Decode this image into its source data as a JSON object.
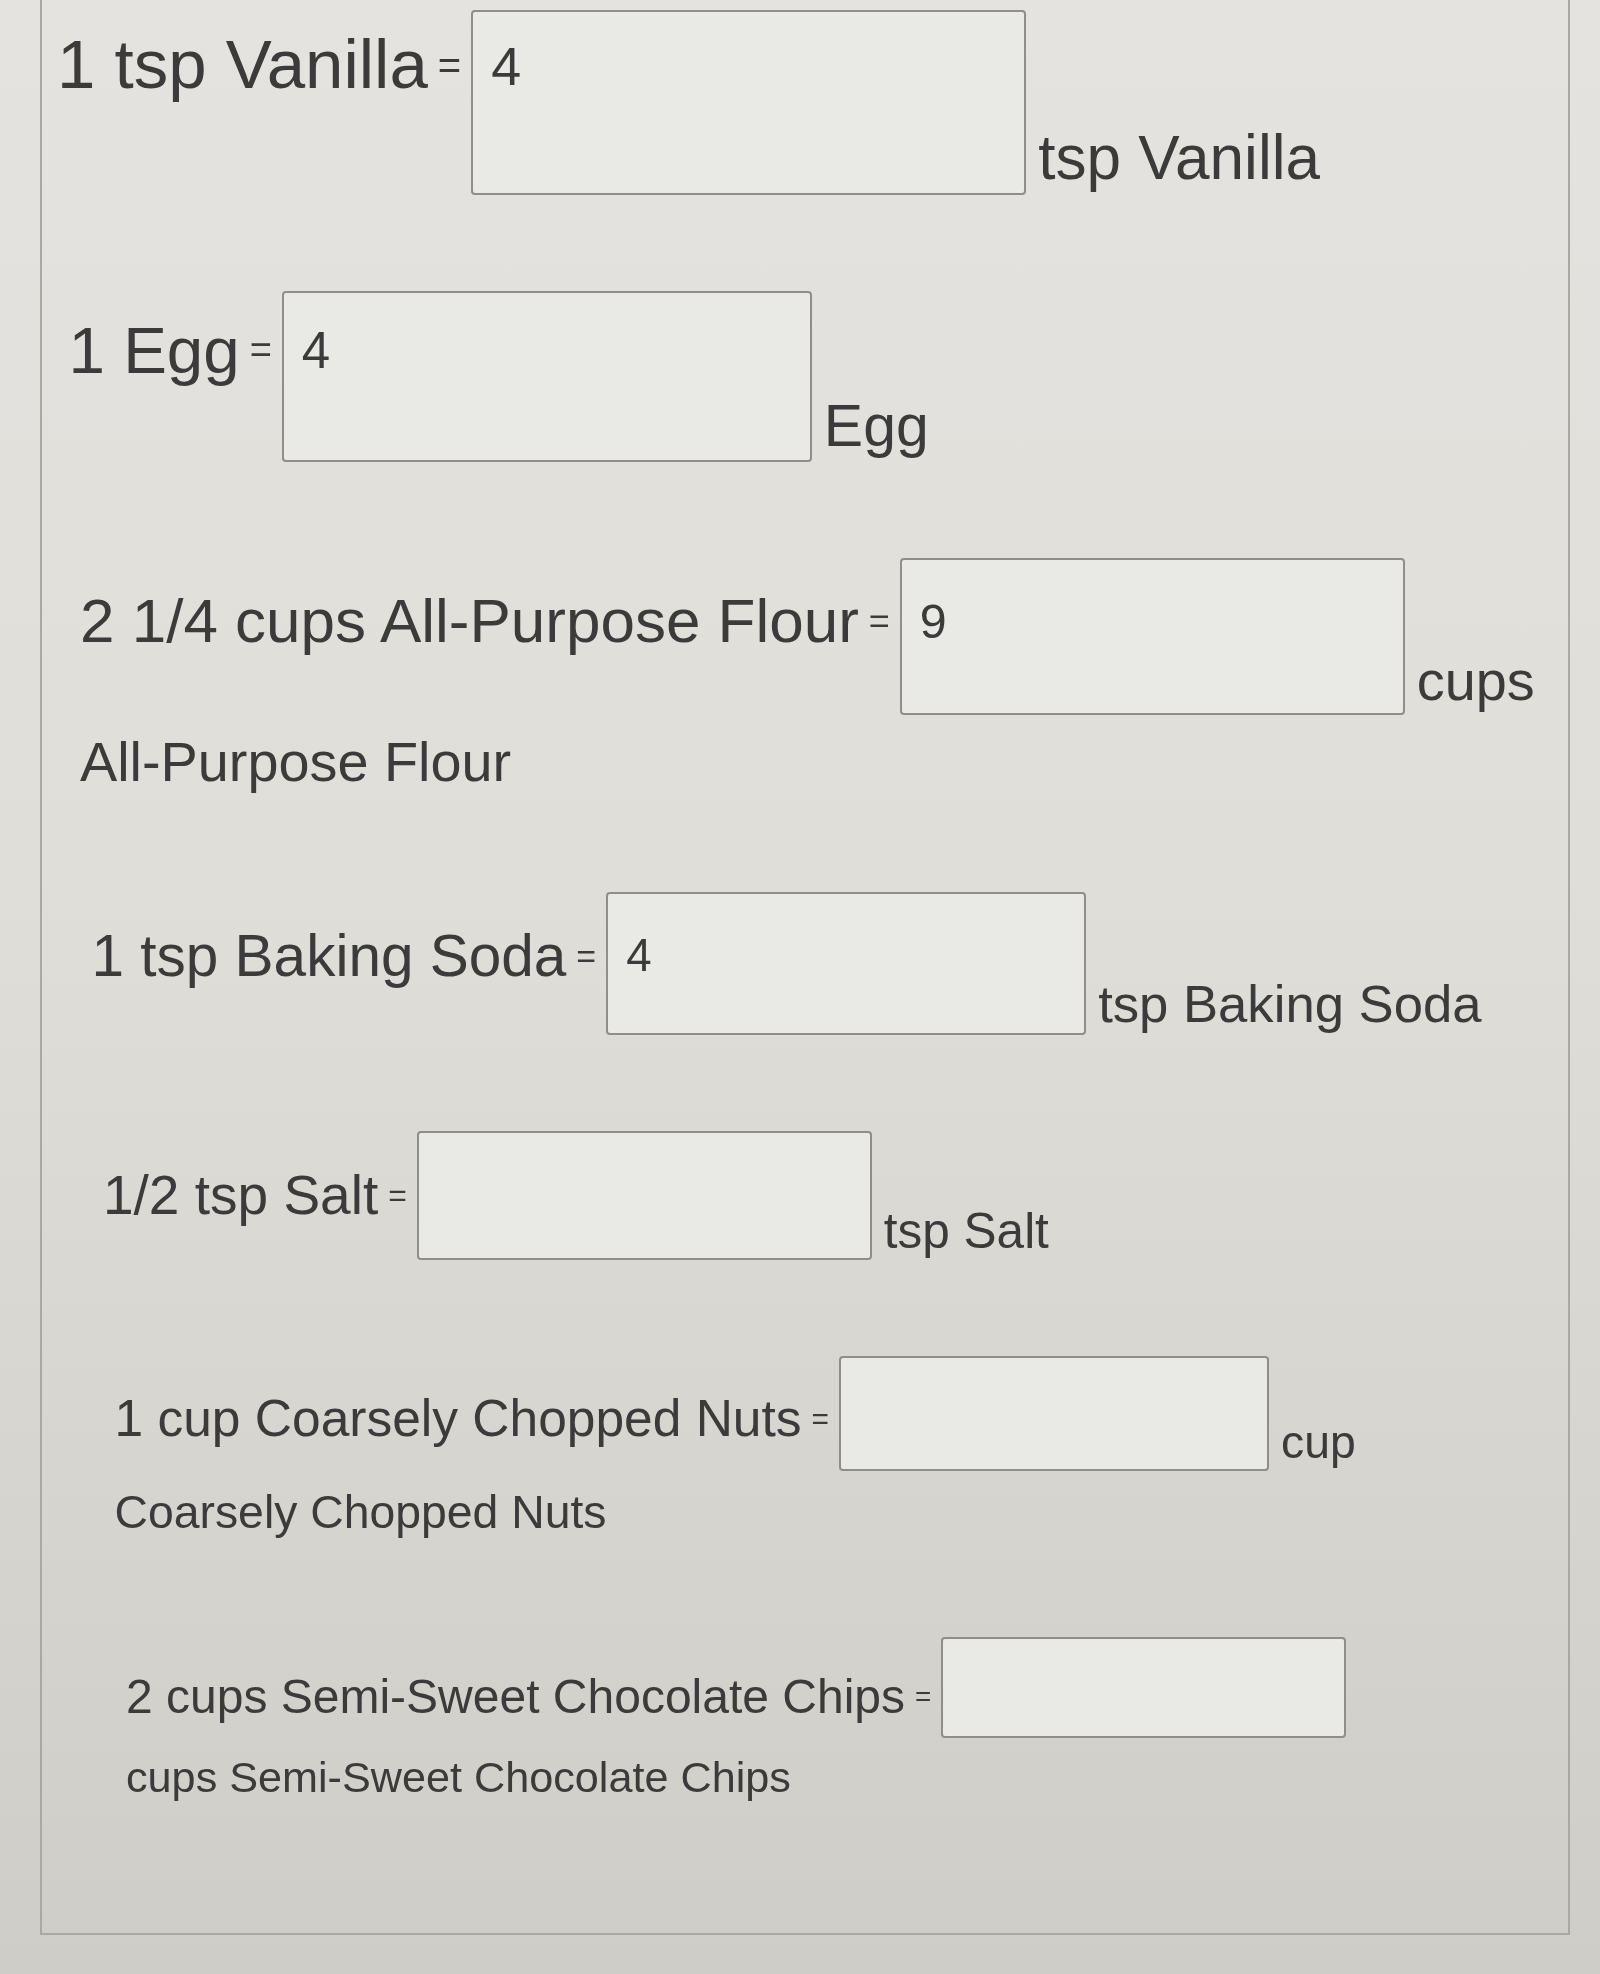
{
  "question": {
    "rows": [
      {
        "label": "1 tsp Vanilla",
        "sign": "=",
        "value": "4",
        "unit": "tsp Vanilla"
      },
      {
        "label": "1 Egg",
        "sign": "=",
        "value": "4",
        "unit": "Egg"
      },
      {
        "label": "2 1/4 cups All-Purpose Flour",
        "sign": "=",
        "value": "9",
        "unit": "cups",
        "unit_continued": "All-Purpose Flour"
      },
      {
        "label": "1 tsp Baking Soda",
        "sign": "=",
        "value": "4",
        "unit": "tsp Baking Soda"
      },
      {
        "label": "1/2 tsp Salt",
        "sign": "=",
        "unit": "tsp Salt"
      },
      {
        "label": "1 cup Coarsely Chopped Nuts",
        "sign": "=",
        "unit": "cup",
        "unit_continued": "Coarsely Chopped Nuts"
      },
      {
        "label": "2 cups Semi-Sweet Chocolate Chips",
        "sign": "=",
        "unit_continued": "cups Semi-Sweet Chocolate Chips"
      }
    ]
  }
}
